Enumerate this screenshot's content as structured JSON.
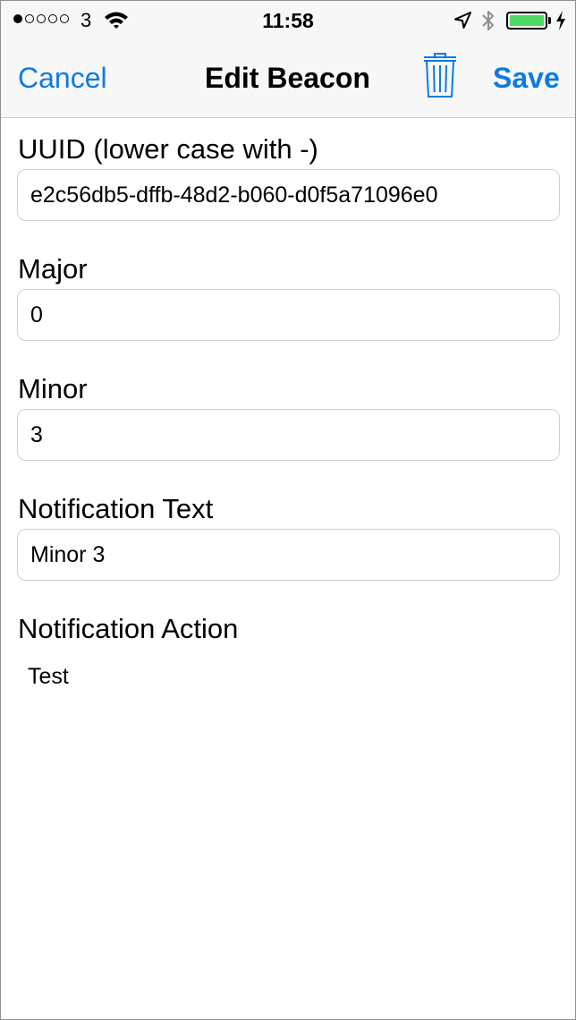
{
  "status_bar": {
    "carrier": "3",
    "signal_bars_filled": 1,
    "signal_bars_total": 5,
    "time": "11:58",
    "battery_level": 1.0,
    "battery_color": "#4cd964",
    "icons": [
      "wifi-icon",
      "location-icon",
      "bluetooth-icon",
      "charging-bolt-icon"
    ]
  },
  "nav": {
    "cancel_label": "Cancel",
    "title": "Edit Beacon",
    "delete_icon": "trash-icon",
    "save_label": "Save",
    "accent_color": "#0e7bde"
  },
  "form": {
    "uuid": {
      "label": "UUID (lower case with -)",
      "value": "e2c56db5-dffb-48d2-b060-d0f5a71096e0"
    },
    "major": {
      "label": "Major",
      "value": "0"
    },
    "minor": {
      "label": "Minor",
      "value": "3"
    },
    "notification_text": {
      "label": "Notification Text",
      "value": "Minor 3"
    },
    "notification_action": {
      "label": "Notification Action",
      "value": "Test"
    }
  }
}
